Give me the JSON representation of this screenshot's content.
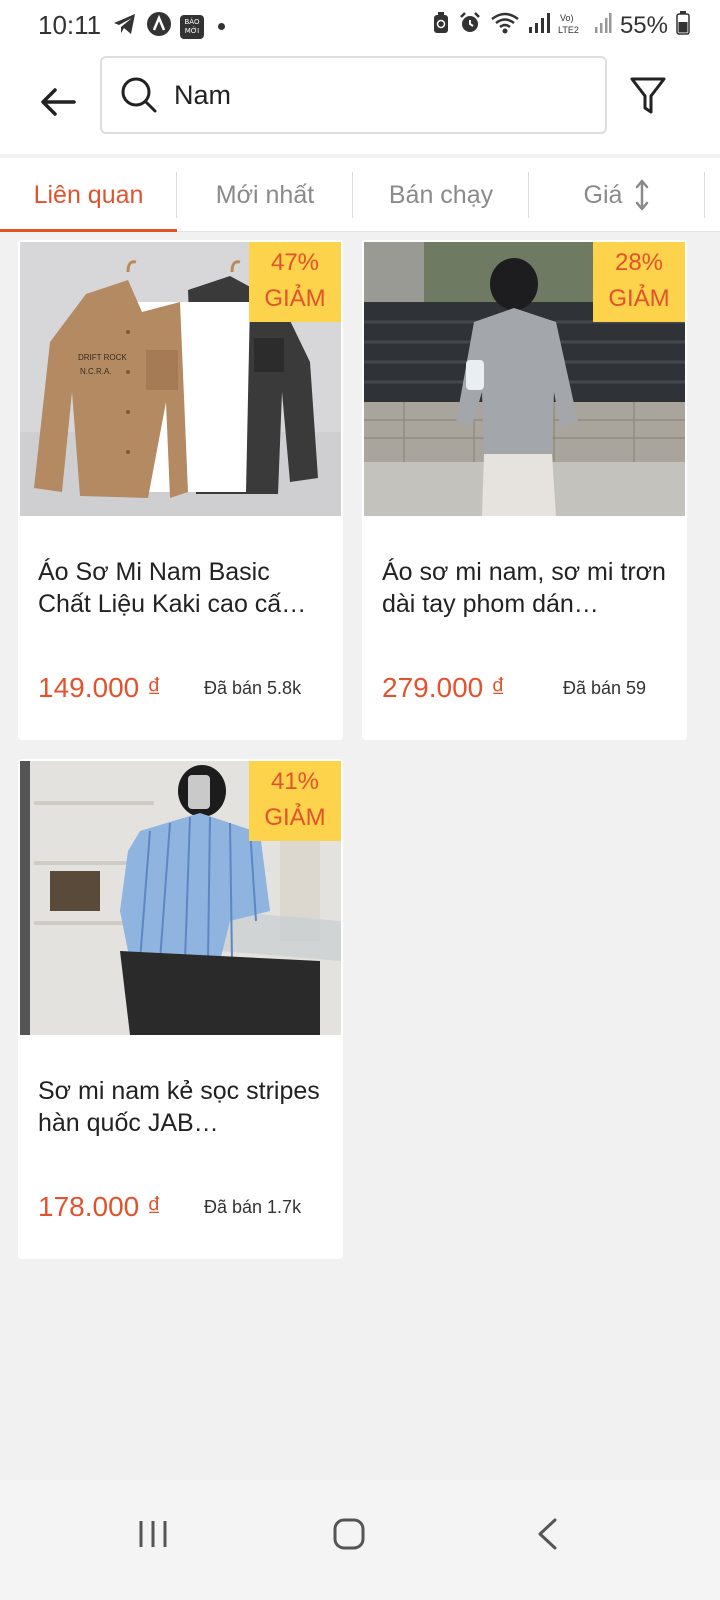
{
  "status_bar": {
    "time": "10:11",
    "battery": "55%",
    "app_badge": "BÁO MỚI"
  },
  "header": {
    "search": {
      "value": "Nam",
      "placeholder": ""
    }
  },
  "tabs": [
    {
      "label": "Liên quan",
      "active": true
    },
    {
      "label": "Mới nhất",
      "active": false
    },
    {
      "label": "Bán chạy",
      "active": false
    },
    {
      "label": "Giá",
      "active": false
    }
  ],
  "products": [
    {
      "title": "Áo Sơ Mi Nam Basic Chất Liệu Kaki cao cấ…",
      "price": "149.000 ₫",
      "sold": "Đã bán 5.8k",
      "discount_pct": "47%",
      "discount_label": "GIẢM"
    },
    {
      "title": "Áo sơ mi nam, sơ mi trơn dài tay phom dán…",
      "price": "279.000 ₫",
      "sold": "Đã bán 59",
      "discount_pct": "28%",
      "discount_label": "GIẢM"
    },
    {
      "title": "Sơ mi nam kẻ sọc stripes hàn quốc JAB…",
      "price": "178.000 ₫",
      "sold": "Đã bán 1.7k",
      "discount_pct": "41%",
      "discount_label": "GIẢM"
    }
  ],
  "colors": {
    "accent": "#e2532d",
    "discount_badge": "#fcd34a",
    "background": "#f1f1f1"
  }
}
